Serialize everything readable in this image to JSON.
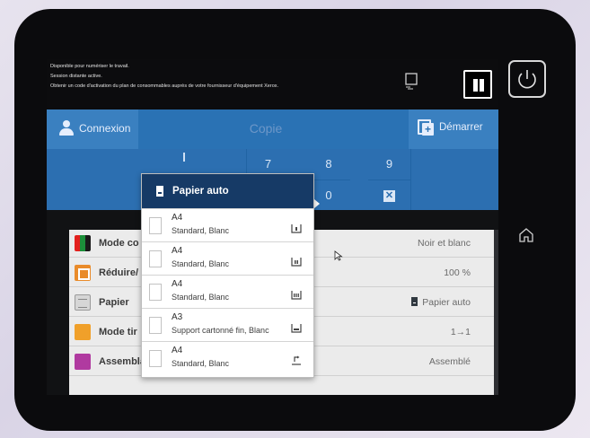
{
  "status": {
    "lines": [
      "Disponible pour numériser le travail.",
      "Session distante active.",
      "Obtenir un code d'activation du plan de consommables auprès de votre fournisseur d'équipement Xerox."
    ]
  },
  "appbar": {
    "connexion_label": "Connexion",
    "title": "Copie",
    "demarrer_label": "Démarrer"
  },
  "keypad": {
    "keys": [
      "7",
      "8",
      "9",
      "0"
    ]
  },
  "settings": {
    "rows": [
      {
        "label": "Mode couleur",
        "visible_label": "Mode co",
        "value": "Noir et blanc"
      },
      {
        "label": "Réduire/Agrandir",
        "visible_label": "Réduire/",
        "value": "100 %"
      },
      {
        "label": "Papier",
        "visible_label": "Papier",
        "value": "Papier auto"
      },
      {
        "label": "Mode tirage",
        "visible_label": "Mode tir",
        "value": "1→1"
      },
      {
        "label": "Assemblage",
        "visible_label": "Assemblage",
        "value": "Assemblé"
      }
    ]
  },
  "dropdown": {
    "header": "Papier auto",
    "items": [
      {
        "size": "A4",
        "desc": "Standard, Blanc",
        "tray": "tray-1-icon"
      },
      {
        "size": "A4",
        "desc": "Standard, Blanc",
        "tray": "tray-2-icon"
      },
      {
        "size": "A4",
        "desc": "Standard, Blanc",
        "tray": "tray-3-icon"
      },
      {
        "size": "A3",
        "desc": "Support cartonné fin, Blanc",
        "tray": "tray-4-icon"
      },
      {
        "size": "A4",
        "desc": "Standard, Blanc",
        "tray": "bypass-tray-icon"
      }
    ]
  },
  "colors": {
    "appbar": "#2a72b4",
    "dropdown_header": "#163a66",
    "settings_bg": "#ebebeb"
  }
}
